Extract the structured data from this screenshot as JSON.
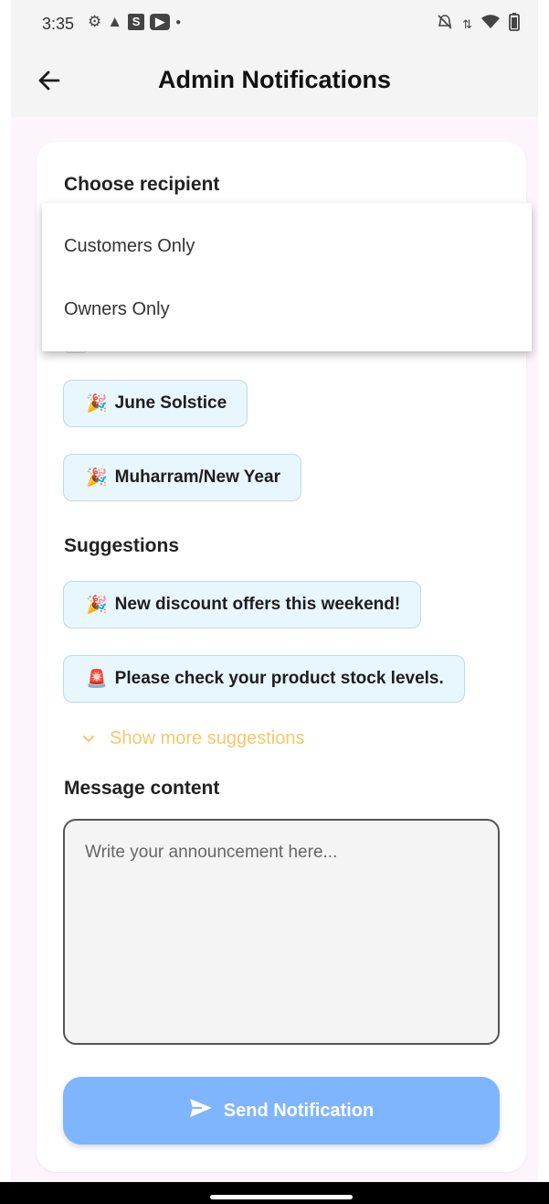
{
  "status_bar": {
    "time": "3:35",
    "left_icons": [
      "gear-icon",
      "warning-icon",
      "s-app-icon",
      "youtube-icon",
      "dot-icon"
    ],
    "right_icons": [
      "bell-off-icon",
      "data-arrows-icon",
      "wifi-icon",
      "battery-icon"
    ],
    "s_glyph": "S"
  },
  "app_bar": {
    "back_icon": "arrow-left-icon",
    "title": "Admin Notifications"
  },
  "form": {
    "recipient_label": "Choose recipient",
    "holiday_heading_icon": "calendar-icon",
    "holiday_chips": [
      {
        "emoji": "🎉",
        "label": "June Solstice"
      },
      {
        "emoji": "🎉",
        "label": "Muharram/New Year"
      }
    ],
    "suggestions_label": "Suggestions",
    "suggestion_chips": [
      {
        "emoji": "🎉",
        "label": "New discount offers this weekend!"
      },
      {
        "emoji": "🚨",
        "label": "Please check your product stock levels."
      }
    ],
    "show_more_label": "Show more suggestions",
    "message_label": "Message content",
    "message_placeholder": "Write your announcement here...",
    "send_label": "Send Notification"
  },
  "recipient_menu": {
    "options": [
      "Customers Only",
      "Owners Only"
    ]
  },
  "colors": {
    "accent_send": "#7fb5ff",
    "show_more": "#f8c76a",
    "chip_bg": "#e8f6fe"
  }
}
